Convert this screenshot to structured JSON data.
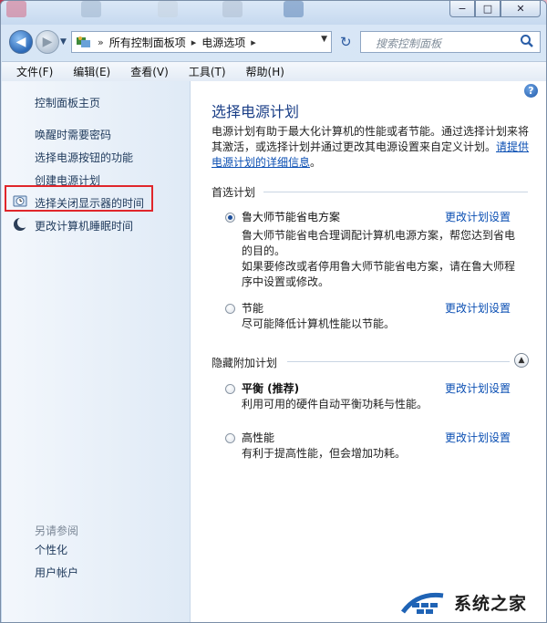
{
  "window": {
    "controls": {
      "minimize": "−",
      "maximize": "□",
      "close": "✕"
    }
  },
  "nav": {
    "back_icon": "arrow-left-icon",
    "breadcrumb": [
      "所有控制面板项",
      "电源选项"
    ],
    "search_placeholder": "搜索控制面板"
  },
  "menu": [
    "文件(F)",
    "编辑(E)",
    "查看(V)",
    "工具(T)",
    "帮助(H)"
  ],
  "sidebar": {
    "home": "控制面板主页",
    "links": [
      "唤醒时需要密码",
      "选择电源按钮的功能",
      "创建电源计划",
      "选择关闭显示器的时间",
      "更改计算机睡眠时间"
    ],
    "see_also_title": "另请参阅",
    "see_also": [
      "个性化",
      "用户帐户"
    ]
  },
  "main": {
    "title": "选择电源计划",
    "desc_text": "电源计划有助于最大化计算机的性能或者节能。通过选择计划来将其激活，或选择计划并通过更改其电源设置来自定义计划。",
    "desc_link_1": "请提供",
    "desc_link_2": "电源计划的详细信息",
    "desc_end": "。",
    "preferred_section": "首选计划",
    "hidden_section": "隐藏附加计划",
    "change_link": "更改计划设置",
    "plans": [
      {
        "name": "鲁大师节能省电方案",
        "desc": "鲁大师节能省电合理调配计算机电源方案，帮您达到省电的目的。",
        "desc2": "如果要修改或者停用鲁大师节能省电方案，请在鲁大师程序中设置或修改。",
        "selected": true
      },
      {
        "name": "节能",
        "desc": "尽可能降低计算机性能以节能。",
        "selected": false
      },
      {
        "name": "平衡 (推荐)",
        "desc": "利用可用的硬件自动平衡功耗与性能。",
        "selected": false
      },
      {
        "name": "高性能",
        "desc": "有利于提高性能，但会增加功耗。",
        "selected": false
      }
    ]
  },
  "watermark": {
    "text": "系统之家"
  },
  "colors": {
    "link": "#0b4fb3",
    "title": "#1b3f87",
    "highlight": "#e0262b"
  }
}
